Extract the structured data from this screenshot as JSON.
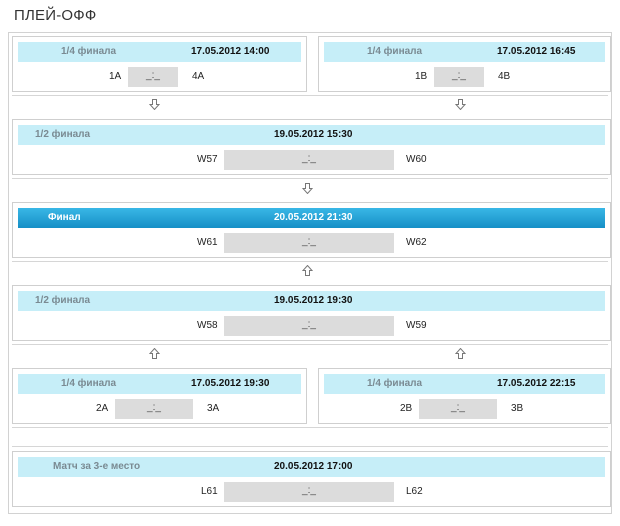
{
  "page": {
    "title": "ПЛЕЙ-ОФФ"
  },
  "matches": {
    "qf1": {
      "round": "1/4 финала",
      "datetime": "17.05.2012 14:00",
      "home": "1A",
      "score": "_:_",
      "away": "4A"
    },
    "qf2": {
      "round": "1/4 финала",
      "datetime": "17.05.2012 16:45",
      "home": "1B",
      "score": "_:_",
      "away": "4B"
    },
    "sf1": {
      "round": "1/2 финала",
      "datetime": "19.05.2012 15:30",
      "home": "W57",
      "score": "_:_",
      "away": "W60"
    },
    "final": {
      "round": "Финал",
      "datetime": "20.05.2012 21:30",
      "home": "W61",
      "score": "_:_",
      "away": "W62"
    },
    "sf2": {
      "round": "1/2 финала",
      "datetime": "19.05.2012 19:30",
      "home": "W58",
      "score": "_:_",
      "away": "W59"
    },
    "qf3": {
      "round": "1/4 финала",
      "datetime": "17.05.2012 19:30",
      "home": "2A",
      "score": "_:_",
      "away": "3A"
    },
    "qf4": {
      "round": "1/4 финала",
      "datetime": "17.05.2012 22:15",
      "home": "2B",
      "score": "_:_",
      "away": "3B"
    },
    "third": {
      "round": "Матч за 3-е место",
      "datetime": "20.05.2012 17:00",
      "home": "L61",
      "score": "_:_",
      "away": "L62"
    }
  },
  "icons": {
    "arrow_down": "arrow-down-icon",
    "arrow_up": "arrow-up-icon"
  },
  "colors": {
    "band": "#c6eef8",
    "final_band": "#1c9bd0",
    "score_box": "#dcdcdc",
    "border": "#cfcfcf"
  }
}
